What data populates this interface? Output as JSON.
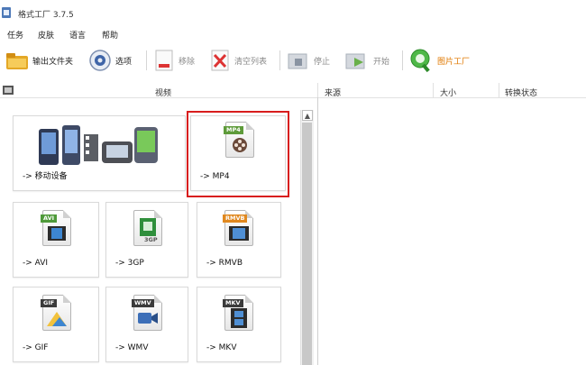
{
  "window": {
    "title": "格式工厂 3.7.5"
  },
  "menu": [
    "任务",
    "皮肤",
    "语言",
    "帮助"
  ],
  "toolbar": {
    "output_folder": "输出文件夹",
    "options": "选项",
    "remove": "移除",
    "clear_list": "清空列表",
    "stop": "停止",
    "start": "开始",
    "picture_factory": "图片工厂"
  },
  "columns": {
    "video": "视频",
    "source": "来源",
    "size": "大小",
    "status": "转换状态"
  },
  "tiles": [
    {
      "label": "-> 移动设备"
    },
    {
      "label": "-> MP4",
      "badge": "MP4"
    },
    {
      "label": "-> AVI",
      "badge": "AVI"
    },
    {
      "label": "-> 3GP",
      "badge": "3GP"
    },
    {
      "label": "-> RMVB",
      "badge": "RMVB"
    },
    {
      "label": "-> GIF",
      "badge": "GIF"
    },
    {
      "label": "-> WMV",
      "badge": "WMV"
    },
    {
      "label": "-> MKV",
      "badge": "MKV"
    }
  ],
  "colors": {
    "highlight": "#d81d1d",
    "picture_factory": "#e07800"
  },
  "scroll": {
    "up_arrow": "▲"
  }
}
